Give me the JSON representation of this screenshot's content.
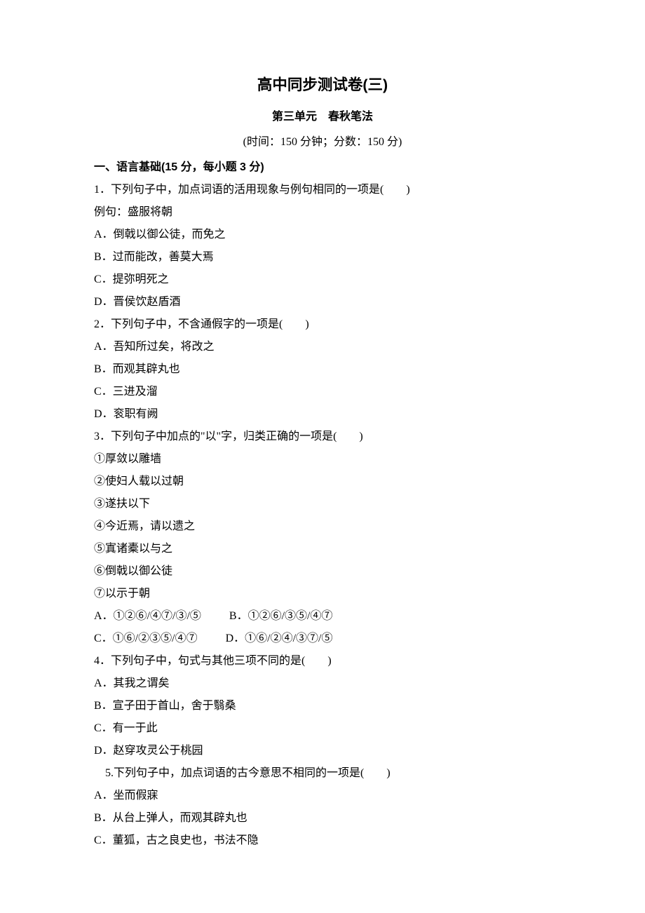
{
  "title": "高中同步测试卷(三)",
  "subtitle": "第三单元　春秋笔法",
  "timing": "(时间：150 分钟；分数：150 分)",
  "section1": {
    "heading": "一、语言基础(15 分，每小题 3 分)",
    "q1": {
      "stem": "1．下列句子中，加点词语的活用现象与例句相同的一项是(　　)",
      "example": "例句：盛服将朝",
      "A": "A．倒戟以御公徒，而免之",
      "B": "B．过而能改，善莫大焉",
      "C": "C．提弥明死之",
      "D": "D．晋侯饮赵盾酒"
    },
    "q2": {
      "stem": "2．下列句子中，不含通假字的一项是(　　)",
      "A": "A．吾知所过矣，将改之",
      "B": "B．而观其辟丸也",
      "C": "C．三进及溜",
      "D": "D．衮职有阙"
    },
    "q3": {
      "stem": "3．下列句子中加点的\"以\"字，归类正确的一项是(　　)",
      "i1": "①厚敛以雕墙",
      "i2": "②使妇人载以过朝",
      "i3": "③遂扶以下",
      "i4": "④今近焉，请以遗之",
      "i5": "⑤寘诸橐以与之",
      "i6": "⑥倒戟以御公徒",
      "i7": "⑦以示于朝",
      "A": "A．①②⑥/④⑦/③/⑤",
      "B": "B．①②⑥/③⑤/④⑦",
      "C": "C．①⑥/②③⑤/④⑦",
      "D": "D．①⑥/②④/③⑦/⑤"
    },
    "q4": {
      "stem": "4．下列句子中，句式与其他三项不同的是(　　)",
      "A": "A．其我之谓矣",
      "B": "B．宣子田于首山，舍于翳桑",
      "C": "C．有一于此",
      "D": "D．赵穿攻灵公于桃园"
    },
    "q5": {
      "stem": "5.下列句子中，加点词语的古今意思不相同的一项是(　　)",
      "A": "A．坐而假寐",
      "B": "B．从台上弹人，而观其辟丸也",
      "C": "C．董狐，古之良史也，书法不隐"
    }
  }
}
